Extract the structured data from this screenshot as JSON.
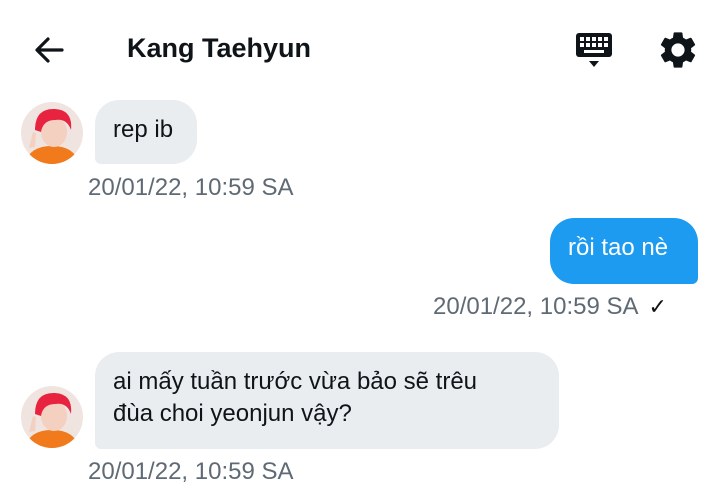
{
  "header": {
    "title": "Kang Taehyun",
    "back_icon": "arrow-left-icon",
    "keyboard_icon": "keyboard-icon",
    "settings_icon": "gear-icon"
  },
  "messages": [
    {
      "direction": "incoming",
      "text": "rep ib",
      "timestamp": "20/01/22, 10:59 SA"
    },
    {
      "direction": "outgoing",
      "text": "rồi tao nè",
      "timestamp": "20/01/22, 10:59 SA",
      "status": "✓"
    },
    {
      "direction": "incoming",
      "text_line1": "ai mấy tuần trước vừa bảo sẽ trêu",
      "text_line2": "đùa choi yeonjun vậy?",
      "timestamp": "20/01/22, 10:59 SA"
    }
  ],
  "colors": {
    "outgoing_bubble": "#1d9bf0",
    "incoming_bubble": "#e9edf0",
    "timestamp": "#5f6a74",
    "avatar_hair": "#e8233f",
    "avatar_shirt": "#f07a1c"
  }
}
